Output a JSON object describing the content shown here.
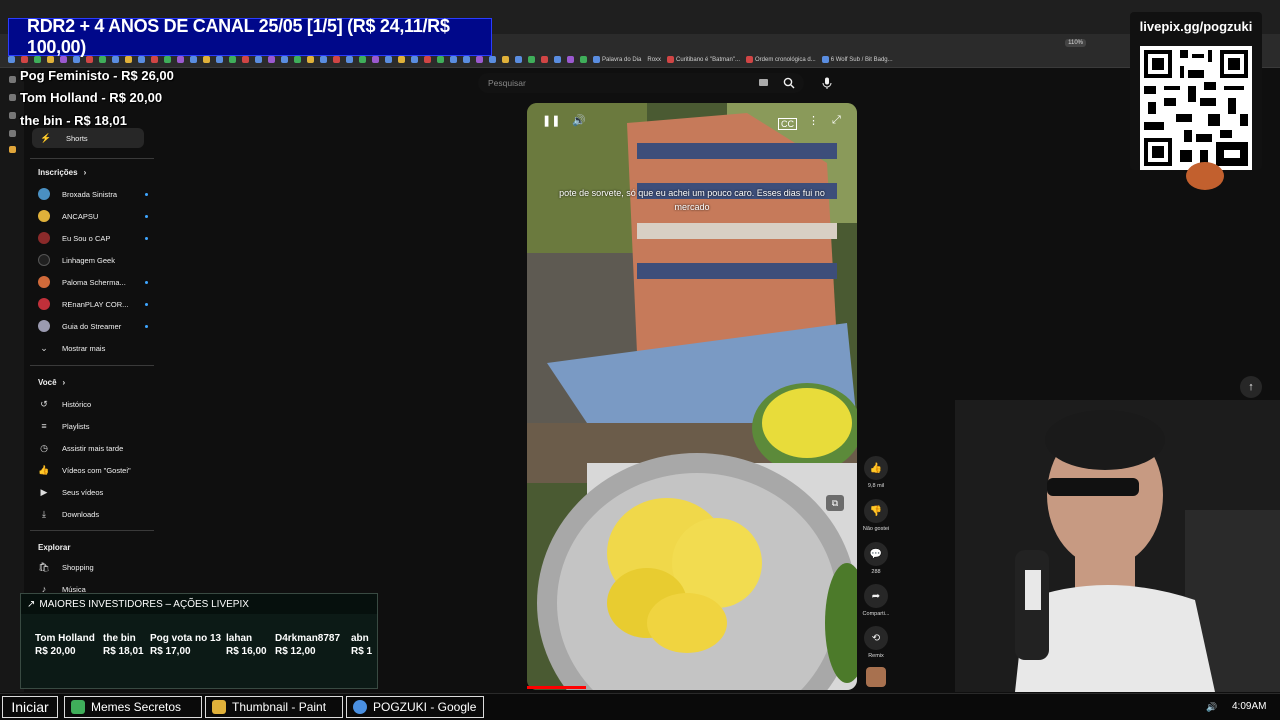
{
  "stream_overlay": {
    "banner": "RDR2 + 4 ANOS DE CANAL 25/05 [1/5] (R$ 24,11/R$ 100,00)",
    "donors": [
      "Pog Feministo - R$ 26,00",
      "Tom Holland - R$ 20,00",
      "the bin - R$ 18,01"
    ],
    "qr_title": "livepix.gg/pogzuki",
    "investors": {
      "title": "MAIORES INVESTIDORES – AÇÕES LIVEPIX",
      "items": [
        {
          "name": "Tom Holland",
          "amount": "R$ 20,00"
        },
        {
          "name": "the bin",
          "amount": "R$ 18,01"
        },
        {
          "name": "Pog vota no 13",
          "amount": "R$ 17,00"
        },
        {
          "name": "lahan",
          "amount": "R$ 16,00"
        },
        {
          "name": "D4rkman8787",
          "amount": "R$ 12,00"
        },
        {
          "name": "abn",
          "amount": "R$ 1"
        }
      ]
    }
  },
  "browser": {
    "zoom": "110%",
    "bookmarks": [
      "Palavra do Dia",
      "Roxx",
      "Curitibano é \"Batman\"...",
      "Ordem cronológica d...",
      "6 Wolf Sub / Bit Badg..."
    ]
  },
  "sidebar": {
    "shorts": "Shorts",
    "subscriptions_title": "Inscrições",
    "channels": [
      {
        "name": "Broxada Sinistra",
        "color": "#4a90c2"
      },
      {
        "name": "ANCAPSU",
        "color": "#e0b13a"
      },
      {
        "name": "Eu Sou o CAP",
        "color": "#8a2a2a"
      },
      {
        "name": "Linhagem Geek",
        "color": "#202020"
      },
      {
        "name": "Paloma Scherma...",
        "color": "#d06a3a"
      },
      {
        "name": "REnanPLAY COR...",
        "color": "#c0303a"
      },
      {
        "name": "Guia do Streamer",
        "color": "#9a9ab0"
      }
    ],
    "show_more": "Mostrar mais",
    "you_title": "Você",
    "you_items": [
      {
        "label": "Histórico",
        "icon": "↺"
      },
      {
        "label": "Playlists",
        "icon": "≡"
      },
      {
        "label": "Assistir mais tarde",
        "icon": "◷"
      },
      {
        "label": "Vídeos com \"Gostei\"",
        "icon": "👍"
      },
      {
        "label": "Seus vídeos",
        "icon": "▶"
      },
      {
        "label": "Downloads",
        "icon": "⤓"
      }
    ],
    "explore_title": "Explorar",
    "explore_items": [
      {
        "label": "Shopping",
        "icon": "🛍"
      },
      {
        "label": "Música",
        "icon": "♪"
      }
    ]
  },
  "search": {
    "placeholder": "Pesquisar"
  },
  "video": {
    "caption": "pote de sorvete, só que eu achei um pouco caro. Esses dias fui no mercado",
    "progress": 0.18
  },
  "actions": {
    "likes": "9,8 mil",
    "dislike": "Não gostei",
    "comments": "288",
    "share": "Comparti...",
    "remix": "Remix"
  },
  "taskbar": {
    "start": "Iniciar",
    "tasks": [
      {
        "label": "Memes Secretos",
        "color": "#3fae5a"
      },
      {
        "label": "Thumbnail - Paint",
        "color": "#e0b13a"
      },
      {
        "label": "POGZUKI - Google",
        "color": "#4a90e2"
      }
    ],
    "clock": "4:09AM"
  }
}
